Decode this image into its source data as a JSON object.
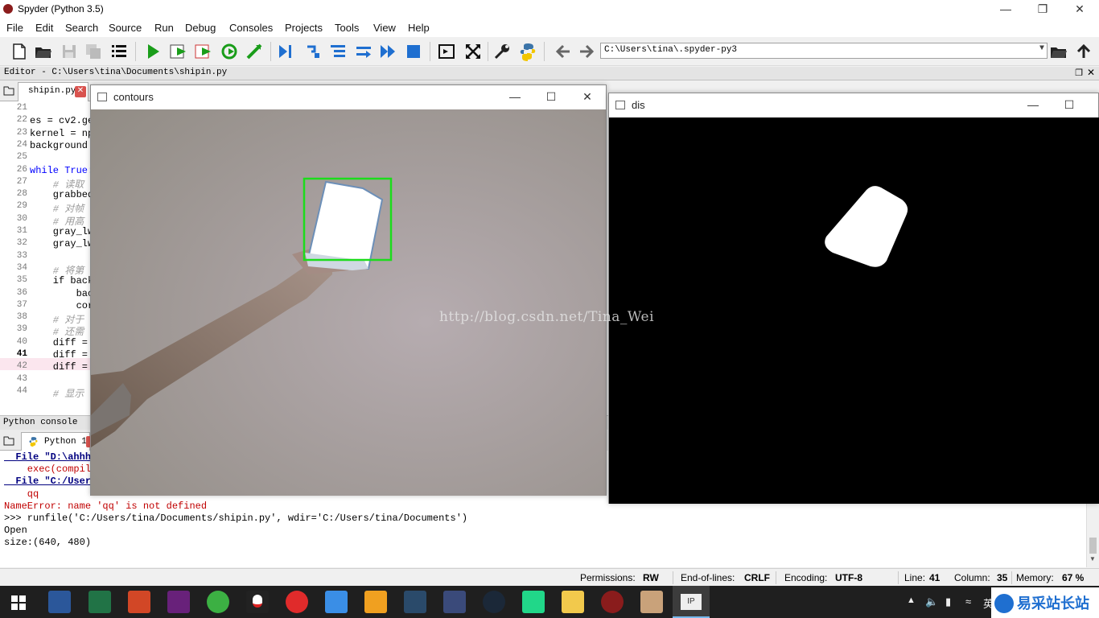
{
  "window": {
    "title": "Spyder (Python 3.5)"
  },
  "menu": [
    "File",
    "Edit",
    "Search",
    "Source",
    "Run",
    "Debug",
    "Consoles",
    "Projects",
    "Tools",
    "View",
    "Help"
  ],
  "toolbar": {
    "path": "C:\\Users\\tina\\.spyder-py3"
  },
  "editor": {
    "title": "Editor - C:\\Users\\tina\\Documents\\shipin.py",
    "tab": "shipin.py",
    "lines": [
      {
        "n": "21",
        "t": ""
      },
      {
        "n": "22",
        "t": "es = cv2.ge"
      },
      {
        "n": "23",
        "t": "kernel = np"
      },
      {
        "n": "24",
        "t": "background"
      },
      {
        "n": "25",
        "t": ""
      },
      {
        "n": "26",
        "t": "while True:"
      },
      {
        "n": "27",
        "t": "    # 读取"
      },
      {
        "n": "28",
        "t": "    grabbed"
      },
      {
        "n": "29",
        "t": "    # 对帧"
      },
      {
        "n": "30",
        "t": "    # 用高"
      },
      {
        "n": "31",
        "t": "    gray_lw"
      },
      {
        "n": "32",
        "t": "    gray_lw"
      },
      {
        "n": "33",
        "t": ""
      },
      {
        "n": "34",
        "t": "    # 将第"
      },
      {
        "n": "35",
        "t": "    if back"
      },
      {
        "n": "36",
        "t": "        bac"
      },
      {
        "n": "37",
        "t": "        cor"
      },
      {
        "n": "38",
        "t": "    # 对于"
      },
      {
        "n": "39",
        "t": "    # 还需"
      },
      {
        "n": "40",
        "t": "    diff ="
      },
      {
        "n": "41",
        "t": "    diff ="
      },
      {
        "n": "42",
        "t": "    diff ="
      },
      {
        "n": "43",
        "t": ""
      },
      {
        "n": "44",
        "t": "    # 显示"
      }
    ]
  },
  "console": {
    "title": "Python console",
    "tab": "Python 1",
    "lines": [
      {
        "t": "  File \"D:\\ahhhh",
        "c": "link"
      },
      {
        "t": "    exec(compile",
        "c": "err"
      },
      {
        "t": "  File \"C:/User",
        "c": "link"
      },
      {
        "t": "    qq",
        "c": "err"
      },
      {
        "t": "NameError: name 'qq' is not defined",
        "c": "err"
      },
      {
        "t": ">>> runfile('C:/Users/tina/Documents/shipin.py', wdir='C:/Users/tina/Documents')",
        "c": ""
      },
      {
        "t": "Open",
        "c": ""
      },
      {
        "t": "size:(640, 480)",
        "c": ""
      }
    ]
  },
  "status": {
    "permissions_label": "Permissions:",
    "permissions": "RW",
    "eol_label": "End-of-lines:",
    "eol": "CRLF",
    "encoding_label": "Encoding:",
    "encoding": "UTF-8",
    "line_label": "Line:",
    "line": "41",
    "column_label": "Column:",
    "column": "35",
    "memory_label": "Memory:",
    "memory": "67 %"
  },
  "contours_window": {
    "title": "contours",
    "watermark": "http://blog.csdn.net/Tina_Wei"
  },
  "dis_window": {
    "title": "dis"
  },
  "taskbar": {
    "ime": "英",
    "badge": "易采站长站"
  },
  "colors": {
    "accent": "#0078d7",
    "contour_box": "#1cdc1c",
    "error": "#c00000"
  }
}
